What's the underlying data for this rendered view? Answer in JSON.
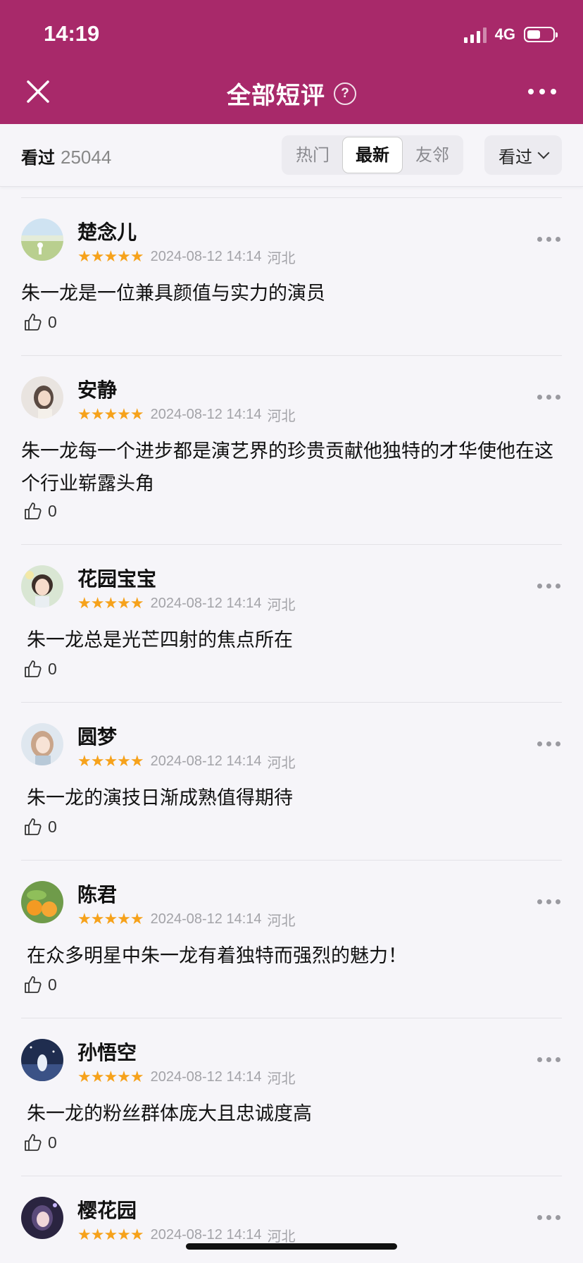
{
  "status_bar": {
    "time": "14:19",
    "network": "4G"
  },
  "nav": {
    "title": "全部短评",
    "help_glyph": "?"
  },
  "filter": {
    "watched_label": "看过",
    "watched_count": "25044",
    "segments": [
      "热门",
      "最新",
      "友邻"
    ],
    "active_segment": "最新",
    "sort_label": "看过"
  },
  "colors": {
    "header": "#a8296a",
    "star": "#f6a21b",
    "meta": "#a3a3a8"
  },
  "rating_stars": "★★★★★",
  "reviews": [
    {
      "name": "楚念儿",
      "date": "2024-08-12 14:14",
      "region": "河北",
      "text": "朱一龙是一位兼具颜值与实力的演员",
      "likes": "0",
      "avatar": "field-avatar"
    },
    {
      "name": "安静",
      "date": "2024-08-12 14:14",
      "region": "河北",
      "text": "朱一龙每一个进步都是演艺界的珍贵贡献他独特的才华使他在这个行业崭露头角",
      "likes": "0",
      "avatar": "girl-portrait-avatar"
    },
    {
      "name": "花园宝宝",
      "date": "2024-08-12 14:14",
      "region": "河北",
      "text": "朱一龙总是光芒四射的焦点所在",
      "likes": "0",
      "avatar": "illustrated-girl-avatar"
    },
    {
      "name": "圆梦",
      "date": "2024-08-12 14:14",
      "region": "河北",
      "text": "朱一龙的演技日渐成熟值得期待",
      "likes": "0",
      "avatar": "anime-girl-avatar"
    },
    {
      "name": "陈君",
      "date": "2024-08-12 14:14",
      "region": "河北",
      "text": "在众多明星中朱一龙有着独特而强烈的魅力！",
      "likes": "0",
      "avatar": "oranges-avatar"
    },
    {
      "name": "孙悟空",
      "date": "2024-08-12 14:14",
      "region": "河北",
      "text": "朱一龙的粉丝群体庞大且忠诚度高",
      "likes": "0",
      "avatar": "night-scene-avatar"
    },
    {
      "name": "樱花园",
      "date": "2024-08-12 14:14",
      "region": "河北",
      "text": "",
      "likes": "",
      "avatar": "dark-portrait-avatar"
    }
  ]
}
